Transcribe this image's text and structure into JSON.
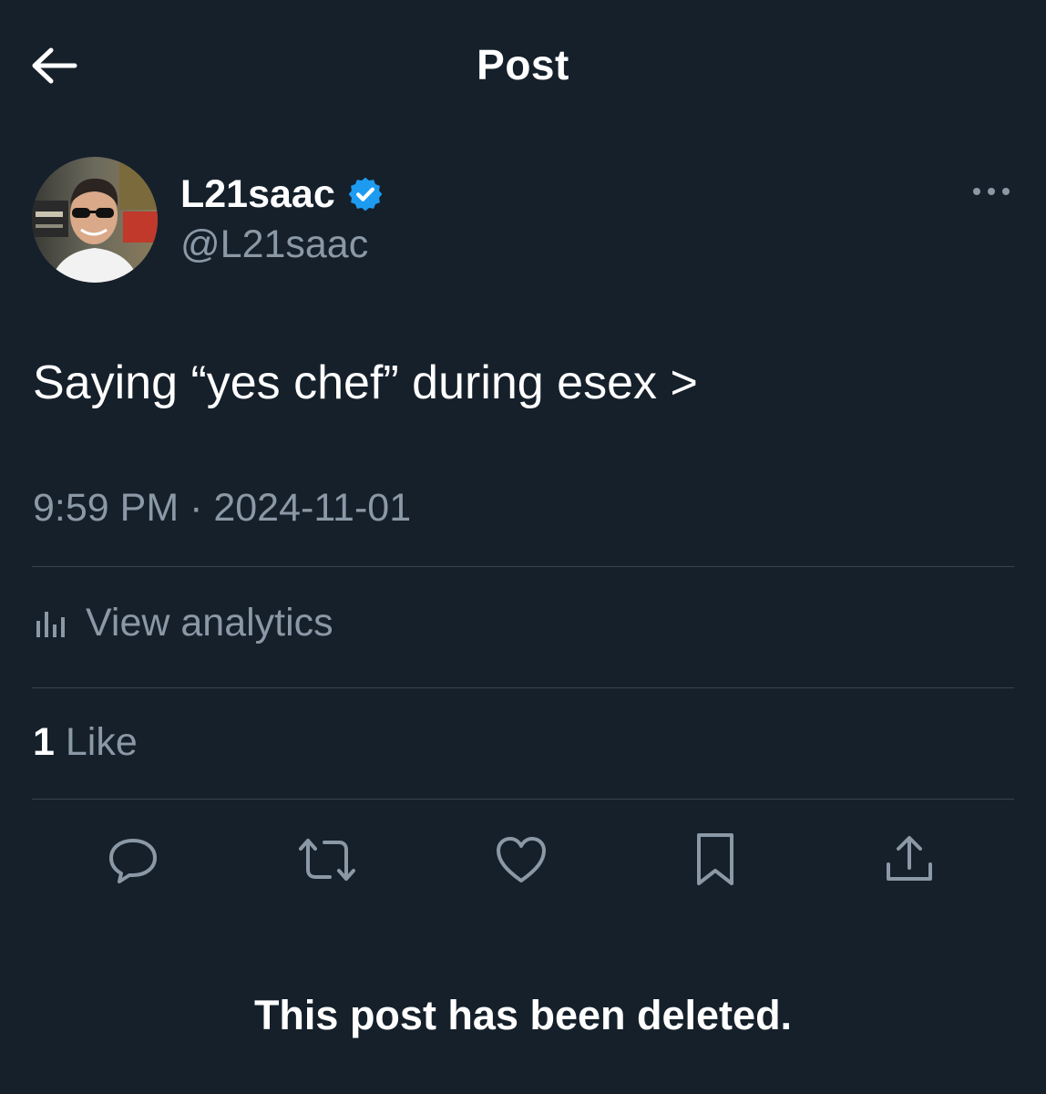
{
  "header": {
    "title": "Post",
    "back_icon": "arrow-left-icon"
  },
  "author": {
    "display_name": "L21saac",
    "handle": "@L21saac",
    "verified": true,
    "verified_color": "#1d9bf0"
  },
  "post": {
    "text": "Saying “yes chef” during esex >",
    "timestamp": "9:59 PM · 2024-11-01"
  },
  "analytics": {
    "label": "View analytics",
    "icon": "bar-chart-icon"
  },
  "likes": {
    "count": "1",
    "label": "Like"
  },
  "actions": [
    {
      "name": "reply",
      "icon": "reply-icon"
    },
    {
      "name": "repost",
      "icon": "repost-icon"
    },
    {
      "name": "like",
      "icon": "heart-icon"
    },
    {
      "name": "bookmark",
      "icon": "bookmark-icon"
    },
    {
      "name": "share",
      "icon": "share-icon"
    }
  ],
  "notice": "This post has been deleted.",
  "colors": {
    "background": "#15202b",
    "secondary_text": "#8b98a5",
    "divider": "#38444d"
  }
}
